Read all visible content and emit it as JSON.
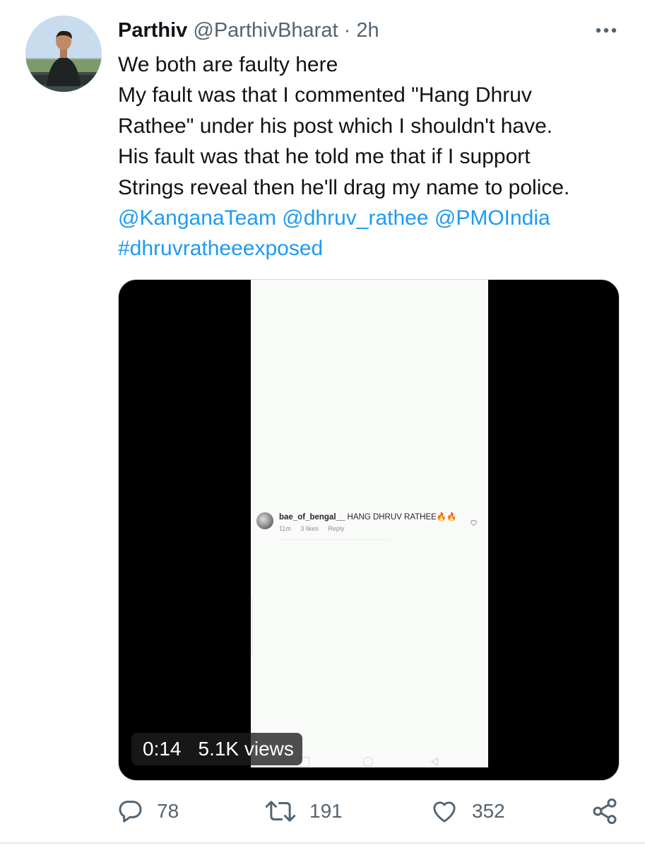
{
  "tweet": {
    "author_name": "Parthiv",
    "author_handle": "@ParthivBharat",
    "separator": "·",
    "time": "2h",
    "text_lines": [
      "We both are faulty here",
      "My fault was that I commented \"Hang Dhruv",
      "Rathee\" under his post which I shouldn't have.",
      "His fault was that he told me that if I support",
      "Strings reveal then he'll drag my name to police."
    ],
    "mentions": [
      "@KanganaTeam",
      "@dhruv_rathee",
      "@PMOIndia"
    ],
    "hashtag": "#dhruvratheeexposed"
  },
  "media": {
    "type": "video",
    "duration": "0:14",
    "views": "5.1K views",
    "embedded_comment": {
      "username": "bae_of_bengal__",
      "text": "HANG DHRUV RATHEE",
      "emoji": "🔥🔥",
      "age": "11m",
      "likes": "3 likes",
      "reply": "Reply"
    }
  },
  "actions": {
    "replies": "78",
    "retweets": "191",
    "likes": "352"
  },
  "icons": {
    "more": "more-horizontal-icon",
    "reply": "reply-icon",
    "retweet": "retweet-icon",
    "like": "heart-icon",
    "share": "share-icon"
  },
  "colors": {
    "link": "#1d9bf0",
    "secondary_text": "#536471",
    "primary_text": "#0f1419",
    "video_bg": "#000000"
  }
}
